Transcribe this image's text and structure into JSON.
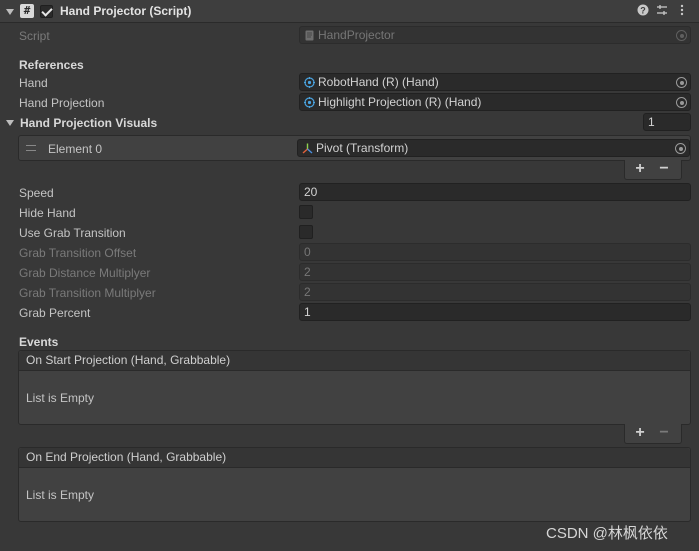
{
  "header": {
    "title": "Hand Projector (Script)",
    "help_icon": "help-icon",
    "settings_icon": "preset-sliders-icon",
    "menu_icon": "kebab-menu-icon"
  },
  "script_row": {
    "label": "Script",
    "value": "HandProjector"
  },
  "references": {
    "title": "References",
    "hand": {
      "label": "Hand",
      "value": "RobotHand (R) (Hand)"
    },
    "hand_projection": {
      "label": "Hand Projection",
      "value": "Highlight Projection (R) (Hand)"
    }
  },
  "visuals": {
    "title": "Hand Projection Visuals",
    "size": "1",
    "elements": [
      {
        "label": "Element 0",
        "value": "Pivot (Transform)"
      }
    ],
    "add_label": "+",
    "remove_label": "−"
  },
  "fields": {
    "speed": {
      "label": "Speed",
      "value": "20"
    },
    "hide_hand": {
      "label": "Hide Hand"
    },
    "use_grab_transition": {
      "label": "Use Grab Transition"
    },
    "grab_transition_offset": {
      "label": "Grab Transition Offset",
      "value": "0"
    },
    "grab_distance_multiplyer": {
      "label": "Grab Distance Multiplyer",
      "value": "2"
    },
    "grab_transition_multiplyer": {
      "label": "Grab Transition Multiplyer",
      "value": "2"
    },
    "grab_percent": {
      "label": "Grab Percent",
      "value": "1"
    }
  },
  "events": {
    "title": "Events",
    "on_start": {
      "title": "On Start Projection (Hand, Grabbable)",
      "empty": "List is Empty"
    },
    "on_end": {
      "title": "On End Projection (Hand, Grabbable)",
      "empty": "List is Empty"
    },
    "add_label": "+",
    "remove_label": "−"
  },
  "watermark": "CSDN @林枫依依",
  "colors": {
    "background": "#383838",
    "field": "#2a2a2a",
    "hand_icon": "#4aa3df"
  }
}
